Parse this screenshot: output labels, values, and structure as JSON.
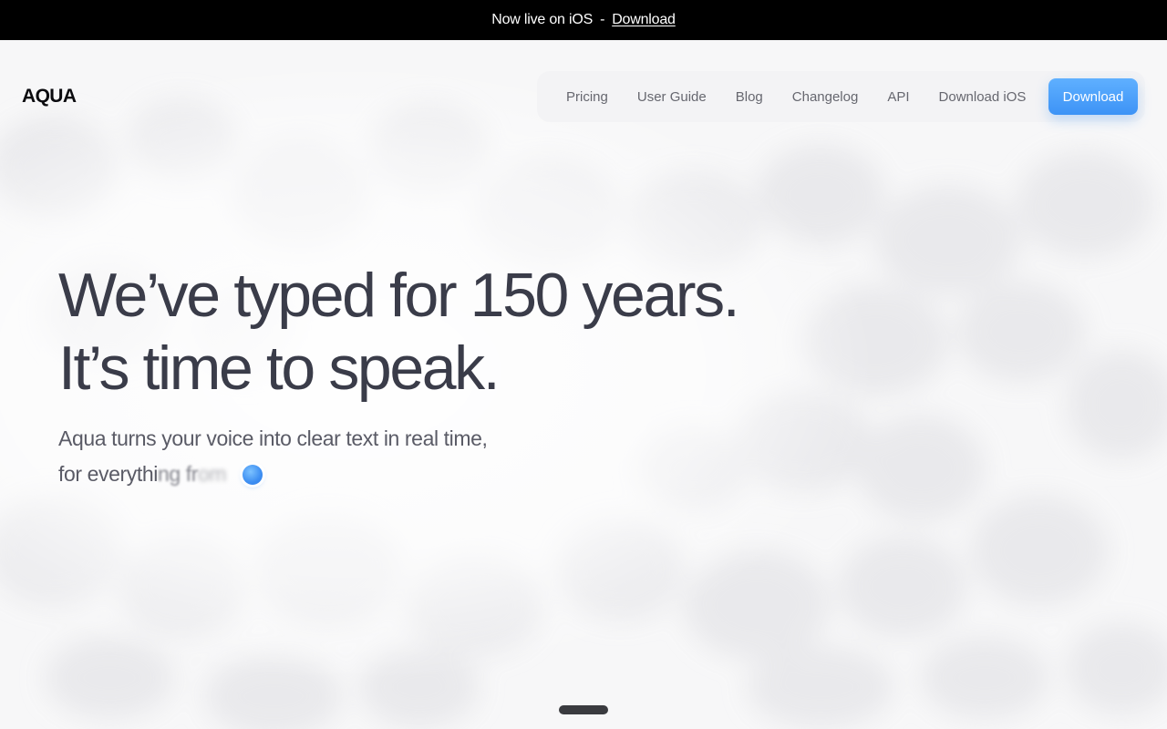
{
  "announcement": {
    "text": "Now live on iOS",
    "separator": "-",
    "link_label": "Download"
  },
  "header": {
    "logo": "AQUA",
    "nav": [
      {
        "label": "Pricing"
      },
      {
        "label": "User Guide"
      },
      {
        "label": "Blog"
      },
      {
        "label": "Changelog"
      },
      {
        "label": "API"
      },
      {
        "label": "Download iOS"
      }
    ],
    "cta_label": "Download"
  },
  "hero": {
    "headline_line1": "We’ve typed for 150 years.",
    "headline_line2": "It’s time to speak.",
    "subline_line1": "Aqua turns your voice into clear text in real time,",
    "typing_solid": "for everythi",
    "typing_fade1": "ng fr",
    "typing_fade2": "om"
  },
  "colors": {
    "accent": "#3d93f6",
    "announcement_bg": "#000000",
    "headline": "#3a3c49"
  },
  "icons": {
    "recording_indicator": "recording-dot-icon"
  }
}
